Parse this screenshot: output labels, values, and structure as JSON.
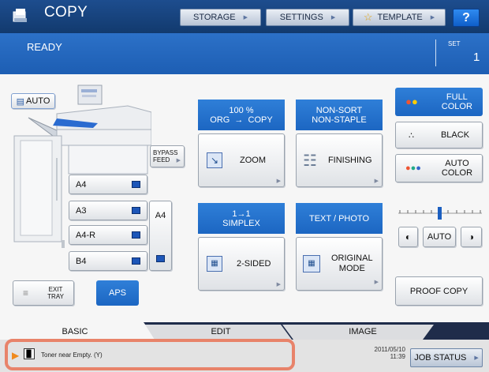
{
  "header": {
    "title": "COPY",
    "buttons": {
      "storage": "STORAGE",
      "settings": "SETTINGS",
      "template": "TEMPLATE",
      "help": "?"
    }
  },
  "status": {
    "state": "READY",
    "set_label": "SET",
    "set_count": "1"
  },
  "left_panel": {
    "auto_label": "AUTO",
    "bypass_label": "BYPASS\nFEED",
    "trays": [
      "A4",
      "A3",
      "A4-R",
      "B4"
    ],
    "lcf_label": "A4",
    "exit_tray_label": "EXIT\nTRAY",
    "aps_label": "APS"
  },
  "middle_panel": {
    "zoom_info": "100 %\nORG  →  COPY",
    "zoom_label": "ZOOM",
    "finishing_info": "NON-SORT\nNON-STAPLE",
    "finishing_label": "FINISHING",
    "sided_info": "1→1\nSIMPLEX",
    "sided_label": "2-SIDED",
    "mode_info": "TEXT / PHOTO",
    "mode_label": "ORIGINAL\nMODE"
  },
  "right_panel": {
    "full_color_label": "FULL\nCOLOR",
    "black_label": "BLACK",
    "auto_color_label": "AUTO\nCOLOR",
    "density_auto": "AUTO",
    "proof_copy_label": "PROOF COPY"
  },
  "tabs": [
    "BASIC",
    "EDIT",
    "IMAGE"
  ],
  "footer": {
    "message": "Toner near Empty. (Y)",
    "date": "2011/05/10",
    "time": "11:39",
    "job_status_label": "JOB STATUS"
  },
  "colors": {
    "header": "#1d4d8e",
    "status_bar": "#2c71c8",
    "info_blue": "#1c66c2",
    "alert_frame": "#e8836a",
    "warning_arrow": "#f08a1c"
  }
}
